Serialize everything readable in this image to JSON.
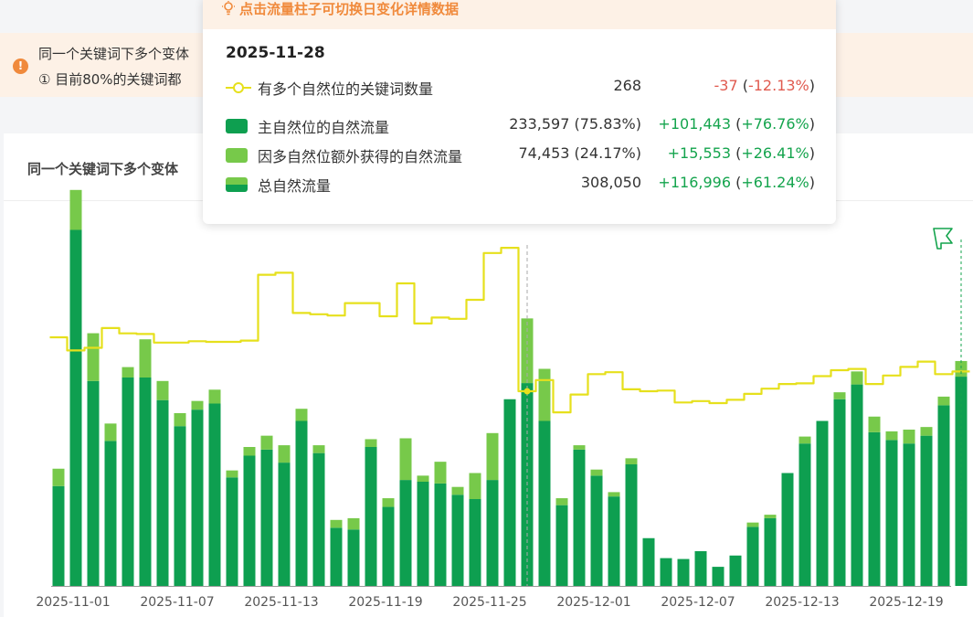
{
  "notice": {
    "icon": "alert-icon",
    "line1": "同一个关键词下多个变体",
    "line2": "① 目前80%的关键词都"
  },
  "panel": {
    "title": "同一个关键词下多个变体"
  },
  "tooltip": {
    "header": "点击流量柱子可切换日变化详情数据",
    "date": "2025-11-28",
    "rows": [
      {
        "label": "有多个自然位的关键词数量",
        "value": "268",
        "change": "-37",
        "change_pct": "-12.13%",
        "trend": "down",
        "symbol": "line"
      },
      {
        "label": "主自然位的自然流量",
        "value": "233,597 (75.83%)",
        "change": "+101,443",
        "change_pct": "+76.76%",
        "trend": "up",
        "symbol": "dark"
      },
      {
        "label": "因多自然位额外获得的自然流量",
        "value": "74,453 (24.17%)",
        "change": "+15,553",
        "change_pct": "+26.41%",
        "trend": "up",
        "symbol": "light"
      },
      {
        "label": "总自然流量",
        "value": "308,050",
        "change": "+116,996",
        "change_pct": "+61.24%",
        "trend": "up",
        "symbol": "combo"
      }
    ]
  },
  "colors": {
    "main": "#0e9f50",
    "extra": "#77c94a",
    "line": "#e6e01c",
    "up": "#14a44d",
    "down": "#e05a4f",
    "accent": "#f08a3c",
    "marker": "#14a44d"
  },
  "chart_data": {
    "type": "bar",
    "x": [
      "2025-11-01",
      "2025-11-02",
      "2025-11-03",
      "2025-11-04",
      "2025-11-05",
      "2025-11-06",
      "2025-11-07",
      "2025-11-08",
      "2025-11-09",
      "2025-11-10",
      "2025-11-11",
      "2025-11-12",
      "2025-11-13",
      "2025-11-14",
      "2025-11-15",
      "2025-11-16",
      "2025-11-17",
      "2025-11-18",
      "2025-11-19",
      "2025-11-20",
      "2025-11-21",
      "2025-11-22",
      "2025-11-23",
      "2025-11-24",
      "2025-11-25",
      "2025-11-26",
      "2025-11-27",
      "2025-11-28",
      "2025-11-29",
      "2025-11-30",
      "2025-12-01",
      "2025-12-02",
      "2025-12-03",
      "2025-12-04",
      "2025-12-05",
      "2025-12-06",
      "2025-12-07",
      "2025-12-08",
      "2025-12-09",
      "2025-12-10",
      "2025-12-11",
      "2025-12-12",
      "2025-12-13",
      "2025-12-14",
      "2025-12-15",
      "2025-12-16",
      "2025-12-17",
      "2025-12-18",
      "2025-12-19",
      "2025-12-20",
      "2025-12-21",
      "2025-12-22",
      "2025-12-23"
    ],
    "xticks": [
      "2025-11-01",
      "2025-11-07",
      "2025-11-13",
      "2025-11-19",
      "2025-11-25",
      "2025-12-01",
      "2025-12-07",
      "2025-12-13",
      "2025-12-19"
    ],
    "series": [
      {
        "name": "主自然位的自然流量",
        "stack": "flow",
        "values": [
          115000,
          410000,
          236000,
          167000,
          240000,
          240000,
          214000,
          184000,
          203000,
          210000,
          125000,
          150000,
          157000,
          142000,
          190000,
          153000,
          67000,
          65000,
          160000,
          91000,
          122000,
          120000,
          118000,
          105000,
          100000,
          122000,
          215000,
          233597,
          190000,
          93000,
          157000,
          127000,
          103000,
          140000,
          55000,
          32000,
          31000,
          40000,
          22000,
          35000,
          68000,
          78000,
          130000,
          164000,
          190000,
          215000,
          232000,
          177000,
          168000,
          164000,
          173000,
          208000,
          241000
        ]
      },
      {
        "name": "因多自然位额外获得的自然流量",
        "stack": "flow",
        "values": [
          20000,
          46000,
          55000,
          20000,
          12000,
          44000,
          22000,
          15000,
          10000,
          16000,
          8000,
          10000,
          16000,
          20000,
          14000,
          9000,
          9000,
          13000,
          9000,
          10000,
          48000,
          7000,
          25000,
          9000,
          30000,
          54000,
          0,
          74453,
          60000,
          8000,
          5000,
          7000,
          5000,
          7000,
          0,
          0,
          0,
          0,
          0,
          0,
          5000,
          4000,
          0,
          8000,
          0,
          8000,
          15000,
          18000,
          10000,
          16000,
          10000,
          10000,
          18000
        ]
      },
      {
        "name": "有多个自然位的关键词数量",
        "type": "line",
        "values": [
          350,
          330,
          334,
          364,
          356,
          355,
          342,
          342,
          344,
          343,
          343,
          345,
          445,
          448,
          387,
          385,
          383,
          402,
          402,
          382,
          432,
          371,
          380,
          378,
          407,
          478,
          486,
          268,
          285,
          236,
          263,
          294,
          297,
          271,
          268,
          269,
          251,
          253,
          250,
          255,
          264,
          272,
          279,
          280,
          291,
          300,
          302,
          279,
          292,
          305,
          313,
          294,
          298
        ]
      }
    ],
    "ylim_flow": [
      0,
      600000
    ],
    "selected": "2025-11-28",
    "latest": "2025-12-23"
  }
}
